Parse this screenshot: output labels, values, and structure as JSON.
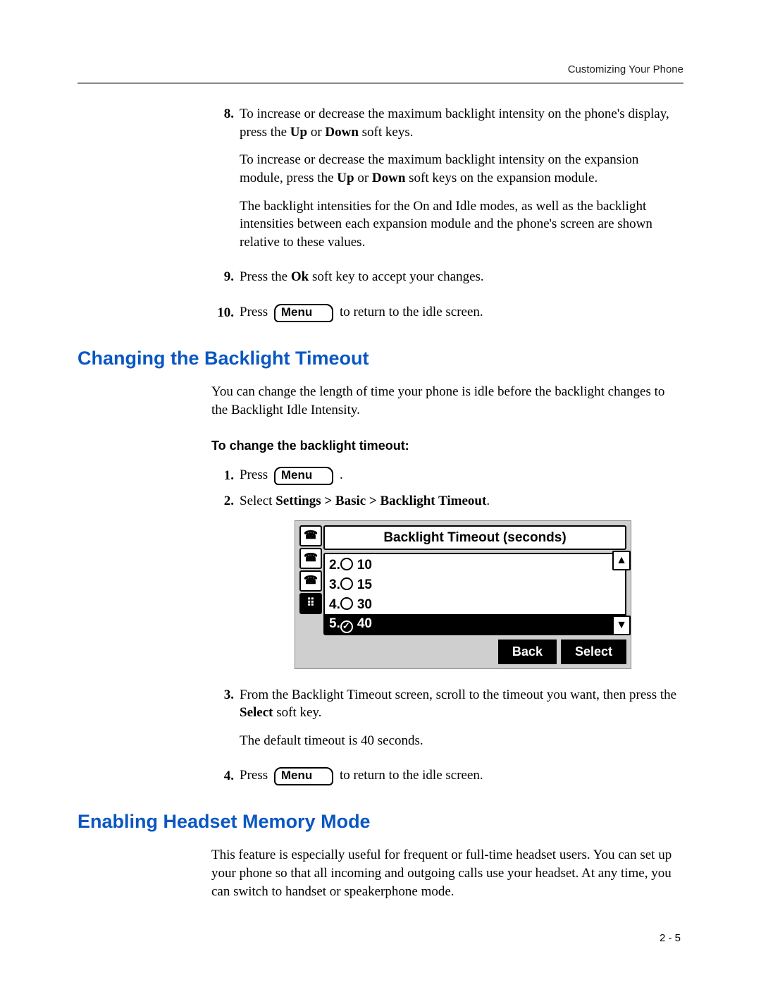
{
  "header": {
    "running": "Customizing Your Phone"
  },
  "step8": {
    "num": "8.",
    "p1a": "To increase or decrease the maximum backlight intensity on the phone's display, press the ",
    "b1": "Up",
    "p1b": " or ",
    "b2": "Down",
    "p1c": " soft keys.",
    "p2a": "To increase or decrease the maximum backlight intensity on the expansion module, press the ",
    "b3": "Up",
    "p2b": " or ",
    "b4": "Down",
    "p2c": " soft keys on the expansion module.",
    "p3": "The backlight intensities for the On and Idle modes, as well as the backlight intensities between each expansion module and the phone's screen are shown relative to these values."
  },
  "step9": {
    "num": "9.",
    "a": "Press the ",
    "b": "Ok",
    "c": " soft key to accept your changes."
  },
  "step10": {
    "num": "10.",
    "a": "Press ",
    "menu": "Menu",
    "b": " to return to the idle screen."
  },
  "section1": {
    "title": "Changing the Backlight Timeout",
    "intro": "You can change the length of time your phone is idle before the backlight changes to the Backlight Idle Intensity.",
    "subhead": "To change the backlight timeout:"
  },
  "s1": {
    "num": "1.",
    "a": "Press ",
    "menu": "Menu",
    "b": " ."
  },
  "s2": {
    "num": "2.",
    "a": "Select ",
    "b": "Settings > Basic > Backlight Timeout",
    "c": "."
  },
  "lcd": {
    "title": "Backlight Timeout (seconds)",
    "rows": [
      {
        "idx": "2.",
        "val": "10",
        "sel": false
      },
      {
        "idx": "3.",
        "val": "15",
        "sel": false
      },
      {
        "idx": "4.",
        "val": "30",
        "sel": false
      },
      {
        "idx": "5.",
        "val": "40",
        "sel": true
      }
    ],
    "back": "Back",
    "select": "Select"
  },
  "s3": {
    "num": "3.",
    "a": "From the Backlight Timeout screen, scroll to the timeout you want, then press the ",
    "b": "Select",
    "c": " soft key.",
    "p2": "The default timeout is 40 seconds."
  },
  "s4": {
    "num": "4.",
    "a": "Press ",
    "menu": "Menu",
    "b": " to return to the idle screen."
  },
  "section2": {
    "title": "Enabling Headset Memory Mode",
    "intro": "This feature is especially useful for frequent or full-time headset users. You can set up your phone so that all incoming and outgoing calls use your headset. At any time, you can switch to handset or speakerphone mode."
  },
  "pagenum": "2 - 5"
}
